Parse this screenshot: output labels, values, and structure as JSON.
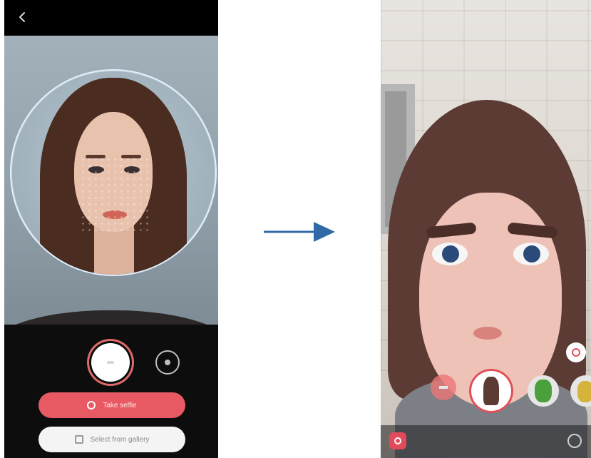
{
  "left_screen": {
    "buttons": {
      "take_selfie_label": "Take selfie",
      "select_from_gallery_label": "Select from gallery"
    },
    "icons": [
      "back-icon",
      "shutter-icon",
      "switch-camera-icon"
    ]
  },
  "right_screen": {
    "icons": [
      "sticker-icon",
      "add-emoji-icon",
      "settings-icon"
    ],
    "avatar_thumbnails": [
      "my-emoji",
      "dinosaur-emoji",
      "character-emoji"
    ]
  },
  "colors": {
    "accent_red": "#e85a63",
    "arrow_blue": "#2f6aa6"
  }
}
